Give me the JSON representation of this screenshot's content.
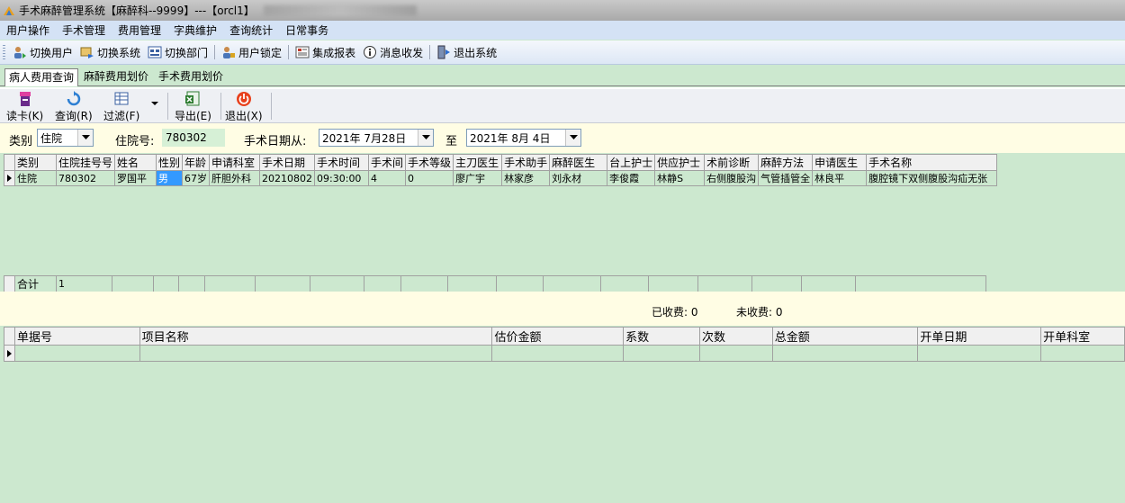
{
  "window": {
    "title": "手术麻醉管理系统【麻醉科--9999】---【orcl1】"
  },
  "menu": [
    "用户操作",
    "手术管理",
    "费用管理",
    "字典维护",
    "查询统计",
    "日常事务"
  ],
  "toolbar": {
    "switch_user": "切换用户",
    "switch_system": "切换系统",
    "switch_dept": "切换部门",
    "user_lock": "用户锁定",
    "integrated_report": "集成报表",
    "messages": "消息收发",
    "exit_system": "退出系统"
  },
  "tabs": [
    "病人费用查询",
    "麻醉费用划价",
    "手术费用划价"
  ],
  "actions": {
    "read_card": "读卡(K)",
    "query": "查询(R)",
    "filter": "过滤(F)",
    "export": "导出(E)",
    "exit": "退出(X)"
  },
  "filters": {
    "category_label": "类别",
    "category_value": "住院",
    "inpatient_label": "住院号:",
    "inpatient_value": "780302",
    "date_from_label": "手术日期从:",
    "date_from_value": "2021年 7月28日",
    "to_label": "至",
    "date_to_value": "2021年 8月 4日"
  },
  "surgery_grid": {
    "columns": [
      "类别",
      "住院挂号号",
      "姓名",
      "性别",
      "年龄",
      "申请科室",
      "手术日期",
      "手术时间",
      "手术间",
      "手术等级",
      "主刀医生",
      "手术助手",
      "麻醉医生",
      "台上护士",
      "供应护士",
      "术前诊断",
      "麻醉方法",
      "申请医生",
      "手术名称"
    ],
    "rows": [
      [
        "住院",
        "780302",
        "罗国平",
        "男",
        "67岁",
        "肝胆外科",
        "20210802",
        "09:30:00",
        "4",
        "0",
        "廖广宇",
        "林家彦",
        "刘永材",
        "李俊霞",
        "林静S",
        "右侧腹股沟",
        "气管插管全",
        "林良平",
        "腹腔镜下双侧腹股沟疝无张"
      ]
    ],
    "total_label": "合计",
    "total_count": "1"
  },
  "summary": {
    "collected": "已收费: 0",
    "uncollected": "未收费: 0"
  },
  "fee_grid": {
    "columns": [
      "单据号",
      "项目名称",
      "估价金额",
      "系数",
      "次数",
      "总金额",
      "开单日期",
      "开单科室"
    ]
  }
}
